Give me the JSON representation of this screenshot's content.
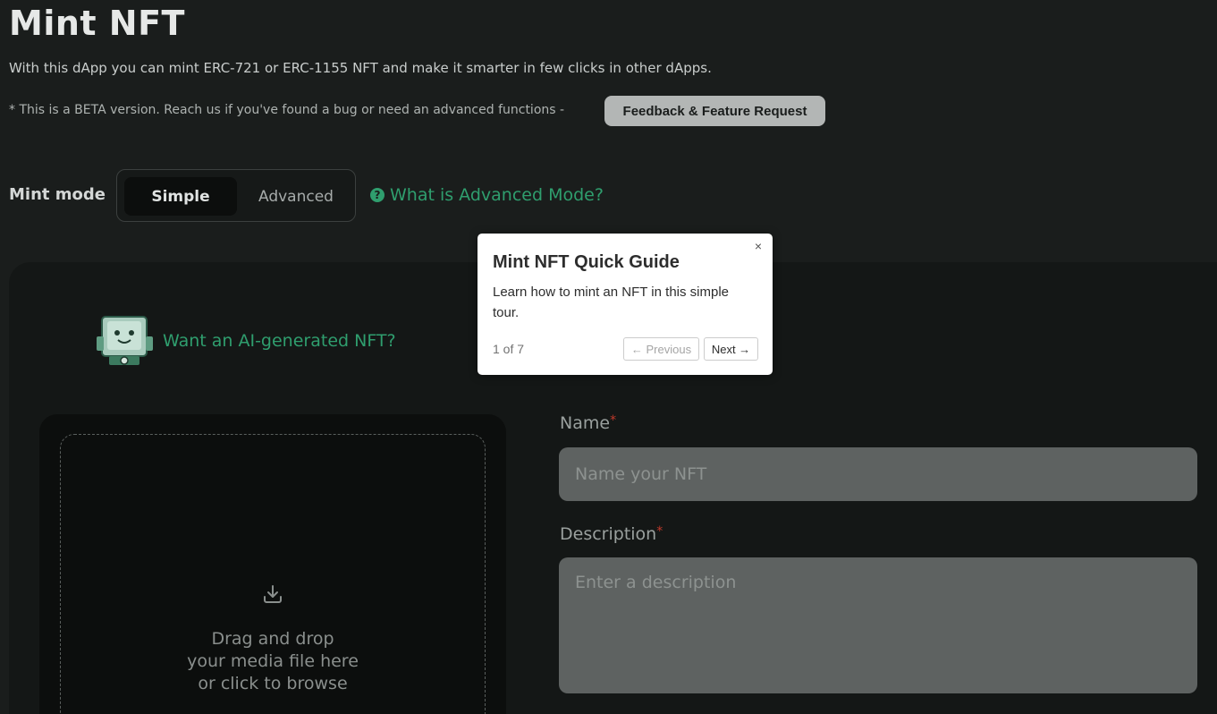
{
  "header": {
    "title": "Mint NFT",
    "intro": "With this dApp you can mint ERC-721 or ERC-1155 NFT and make it smarter in few clicks in other dApps.",
    "beta_note": "* This is a BETA version. Reach us if you've found a bug or need an advanced functions -",
    "feedback_label": "Feedback & Feature Request"
  },
  "mint_mode": {
    "label": "Mint mode",
    "options": [
      "Simple",
      "Advanced"
    ],
    "selected": "Simple",
    "help_link": "What is Advanced Mode?",
    "help_icon": "question-circle-icon"
  },
  "ai": {
    "link": "Want an AI-generated NFT?",
    "icon": "robot-icon"
  },
  "upload": {
    "icon": "upload-icon",
    "line1": "Drag and drop",
    "line2": "your media file here",
    "line3": "or click to browse"
  },
  "form": {
    "name_label": "Name",
    "name_placeholder": "Name your NFT",
    "description_label": "Description",
    "description_placeholder": "Enter a description",
    "required_mark": "*"
  },
  "guide": {
    "close": "×",
    "title": "Mint NFT Quick Guide",
    "description": "Learn how to mint an NFT in this simple tour.",
    "progress": "1 of 7",
    "prev_label": "← Previous",
    "next_label": "Next →"
  },
  "colors": {
    "accent": "#2f9e6e",
    "background": "#1a1d1c",
    "required": "#c0392b"
  }
}
